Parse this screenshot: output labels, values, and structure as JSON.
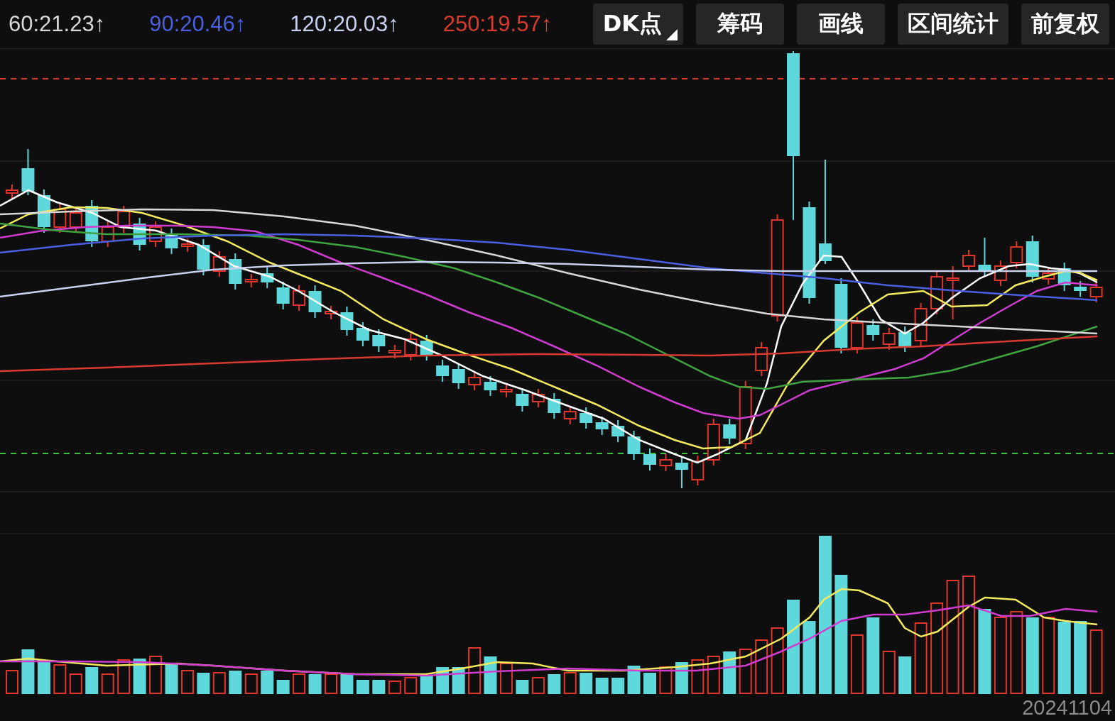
{
  "indicators": [
    {
      "label": "60:21.23↑",
      "color": "#d8d8d8"
    },
    {
      "label": "90:20.46↑",
      "color": "#4a5fe0"
    },
    {
      "label": "120:20.03↑",
      "color": "#c8d0f0"
    },
    {
      "label": "250:19.57↑",
      "color": "#d93a30"
    }
  ],
  "buttons": [
    {
      "label": "DK点",
      "has_menu": true
    },
    {
      "label": "筹码",
      "has_menu": false
    },
    {
      "label": "画线",
      "has_menu": false
    },
    {
      "label": "区间统计",
      "has_menu": false
    },
    {
      "label": "前复权",
      "has_menu": false
    }
  ],
  "date_label": "20241104"
}
